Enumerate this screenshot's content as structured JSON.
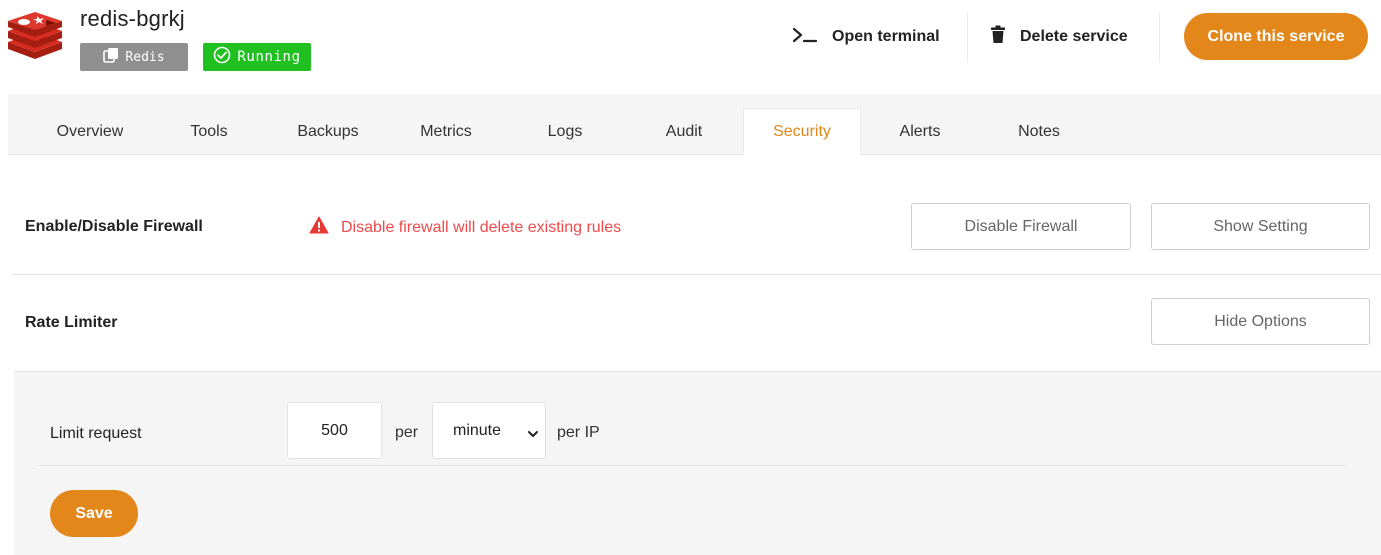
{
  "service": {
    "name": "redis-bgrkj",
    "type_badge": "Redis",
    "status_badge": "Running",
    "logo_icon": "redis-logo-icon"
  },
  "header_actions": {
    "open_terminal": "Open terminal",
    "delete_service": "Delete service",
    "clone_service": "Clone this service"
  },
  "tabs": [
    {
      "label": "Overview",
      "active": false
    },
    {
      "label": "Tools",
      "active": false
    },
    {
      "label": "Backups",
      "active": false
    },
    {
      "label": "Metrics",
      "active": false
    },
    {
      "label": "Logs",
      "active": false
    },
    {
      "label": "Audit",
      "active": false
    },
    {
      "label": "Security",
      "active": true
    },
    {
      "label": "Alerts",
      "active": false
    },
    {
      "label": "Notes",
      "active": false
    }
  ],
  "firewall": {
    "label": "Enable/Disable Firewall",
    "warning": "Disable firewall will delete existing rules",
    "disable_button": "Disable Firewall",
    "show_setting_button": "Show Setting"
  },
  "rate_limiter": {
    "label": "Rate Limiter",
    "hide_options_button": "Hide Options",
    "limit_label": "Limit request",
    "limit_value": "500",
    "per_text": "per",
    "unit_selected": "minute",
    "per_ip_text": "per IP",
    "save_button": "Save"
  },
  "colors": {
    "accent": "#e4871b",
    "running_green": "#1fc01f",
    "badge_gray": "#8f8f8f",
    "warning_red": "#ef4b4b",
    "panel_bg": "#f5f5f5"
  }
}
